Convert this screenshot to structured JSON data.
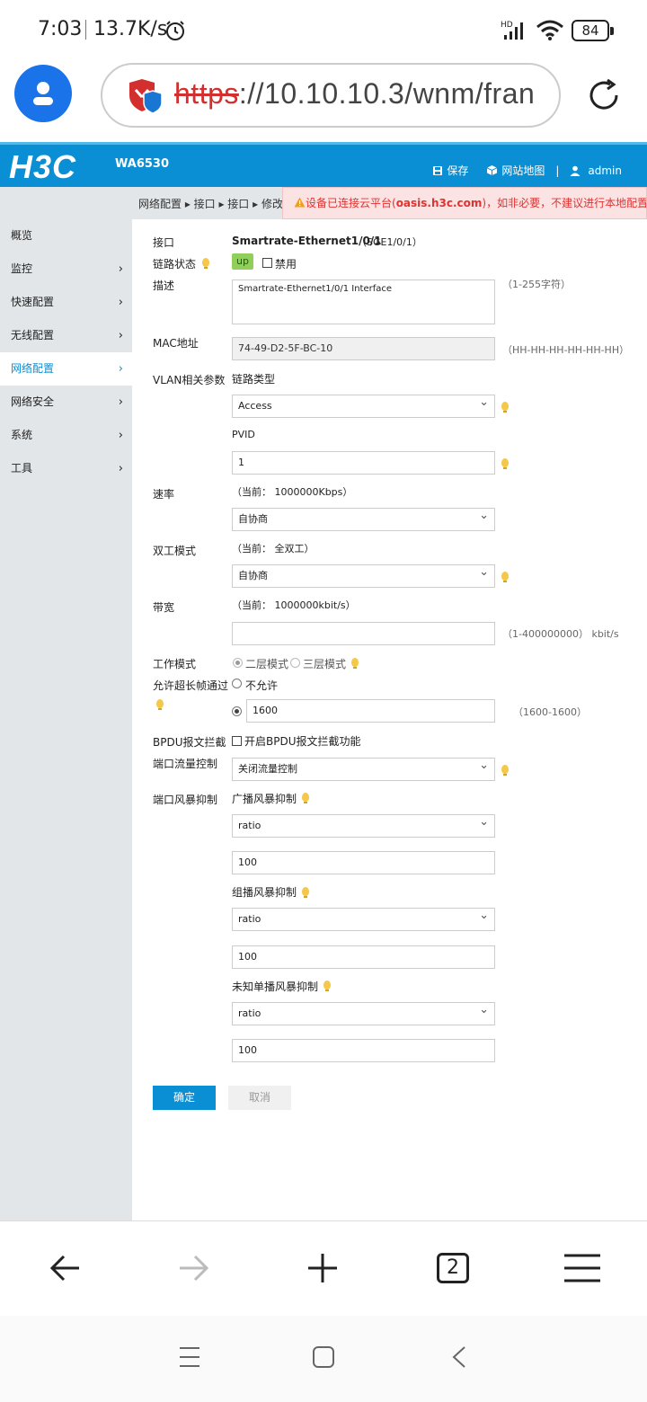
{
  "status_bar": {
    "time": "7:03",
    "speed": "13.7K/s",
    "network": "HD",
    "battery": "84"
  },
  "browser": {
    "url_scheme": "https",
    "url_rest": "://10.10.10.3/wnm/fran",
    "tab_count": "2"
  },
  "header": {
    "logo": "H3C",
    "model": "WA6530",
    "save_label": "保存",
    "sitemap_label": "网站地图",
    "separator": "|",
    "user": "admin"
  },
  "breadcrumb": "网络配置 ▸ 接口 ▸ 接口 ▸ 修改接口",
  "alert": {
    "prefix": "设备已连接云平台(",
    "domain": "oasis.h3c.com",
    "suffix": ")，如非必要，不建议进行本地配置。"
  },
  "sidebar": {
    "items": [
      {
        "label": "概览",
        "arrow": ""
      },
      {
        "label": "监控",
        "arrow": "›"
      },
      {
        "label": "快速配置",
        "arrow": "›"
      },
      {
        "label": "无线配置",
        "arrow": "›"
      },
      {
        "label": "网络配置",
        "arrow": "›"
      },
      {
        "label": "网络安全",
        "arrow": "›"
      },
      {
        "label": "系统",
        "arrow": "›"
      },
      {
        "label": "工具",
        "arrow": "›"
      }
    ]
  },
  "form": {
    "interface_label": "接口",
    "interface_name": "Smartrate-Ethernet1/0/1",
    "interface_alias": "（SGE1/0/1）",
    "link_status_label": "链路状态",
    "link_status": "up",
    "disable_label": "禁用",
    "desc_label": "描述",
    "desc_value": "Smartrate-Ethernet1/0/1 Interface",
    "desc_hint": "（1-255字符）",
    "mac_label": "MAC地址",
    "mac_value": "74-49-D2-5F-BC-10",
    "mac_hint": "（HH-HH-HH-HH-HH-HH）",
    "vlan_label": "VLAN相关参数",
    "link_type_label": "链路类型",
    "link_type_value": "Access",
    "pvid_label": "PVID",
    "pvid_value": "1",
    "speed_label": "速率",
    "speed_current": "（当前： 1000000Kbps）",
    "speed_value": "自协商",
    "duplex_label": "双工模式",
    "duplex_current": "（当前： 全双工）",
    "duplex_value": "自协商",
    "bandwidth_label": "带宽",
    "bandwidth_current": "（当前： 1000000kbit/s）",
    "bandwidth_value": "",
    "bandwidth_hint": "（1-400000000） kbit/s",
    "work_mode_label": "工作模式",
    "work_mode_l2": "二层模式",
    "work_mode_l3": "三层模式",
    "jumbo_label": "允许超长帧通过",
    "jumbo_deny": "不允许",
    "jumbo_value": "1600",
    "jumbo_hint": "（1600-1600）",
    "bpdu_label": "BPDU报文拦截",
    "bpdu_option": "开启BPDU报文拦截功能",
    "flow_label": "端口流量控制",
    "flow_value": "关闭流量控制",
    "storm_label": "端口风暴抑制",
    "broadcast_label": "广播风暴抑制",
    "broadcast_mode": "ratio",
    "broadcast_value": "100",
    "multicast_label": "组播风暴抑制",
    "multicast_mode": "ratio",
    "multicast_value": "100",
    "unicast_label": "未知单播风暴抑制",
    "unicast_mode": "ratio",
    "unicast_value": "100",
    "ok_label": "确定",
    "cancel_label": "取消"
  },
  "colors": {
    "brand_blue": "#0b8fd4",
    "alert_red": "#d33333",
    "status_green": "#8fcf5a"
  }
}
